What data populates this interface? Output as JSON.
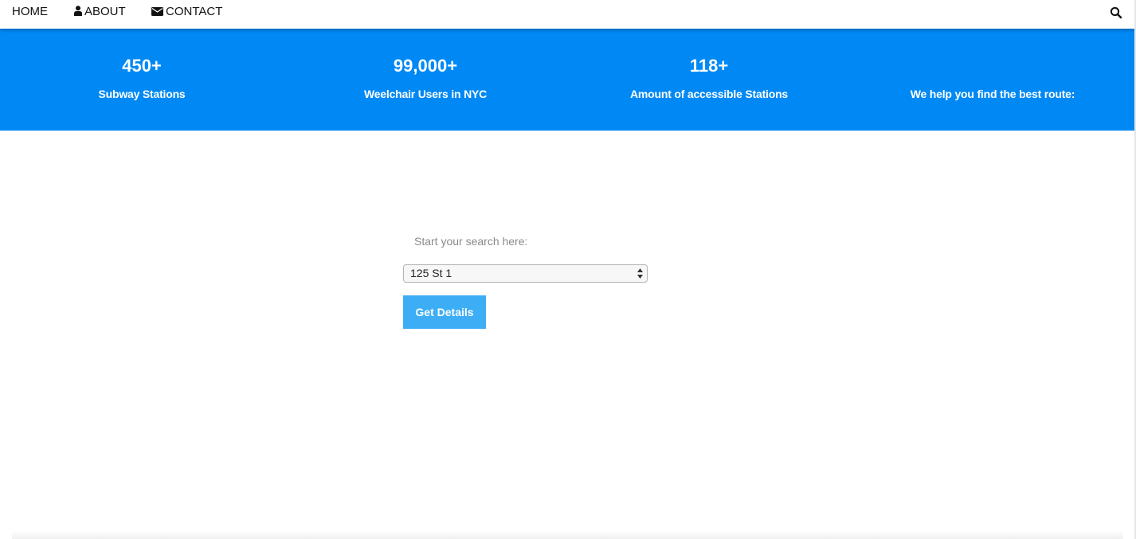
{
  "nav": {
    "home": "HOME",
    "about": "ABOUT",
    "contact": "CONTACT",
    "search_icon": "search-icon",
    "about_icon": "user-icon",
    "contact_icon": "envelope-icon"
  },
  "stats": [
    {
      "value": "450+",
      "label": "Subway Stations"
    },
    {
      "value": "99,000+",
      "label": "Weelchair Users in NYC"
    },
    {
      "value": "118+",
      "label": "Amount of accessible Stations"
    },
    {
      "value": "",
      "label": "We help you find the best route:"
    }
  ],
  "search": {
    "label": "Start your search here:",
    "selected_station": "125 St 1",
    "button_label": "Get Details"
  },
  "colors": {
    "banner": "#0089f5",
    "button": "#3daef5",
    "nav_text": "#111111"
  }
}
